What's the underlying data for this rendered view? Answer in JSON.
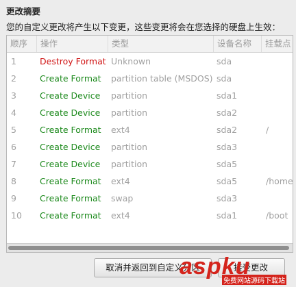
{
  "dialog": {
    "title": "更改摘要",
    "description": "您的自定义更改将产生以下变更，这些变更将会在您选择的硬盘上生效："
  },
  "table": {
    "headers": [
      "顺序",
      "操作",
      "类型",
      "设备名称",
      "挂载点"
    ],
    "rows": [
      {
        "order": "1",
        "action": "Destroy Format",
        "action_kind": "destroy",
        "type": "Unknown",
        "device": "sda",
        "mount": ""
      },
      {
        "order": "2",
        "action": "Create Format",
        "action_kind": "create",
        "type": "partition table (MSDOS)",
        "device": "sda",
        "mount": ""
      },
      {
        "order": "3",
        "action": "Create Device",
        "action_kind": "create",
        "type": "partition",
        "device": "sda1",
        "mount": ""
      },
      {
        "order": "4",
        "action": "Create Device",
        "action_kind": "create",
        "type": "partition",
        "device": "sda2",
        "mount": ""
      },
      {
        "order": "5",
        "action": "Create Format",
        "action_kind": "create",
        "type": "ext4",
        "device": "sda2",
        "mount": "/"
      },
      {
        "order": "6",
        "action": "Create Device",
        "action_kind": "create",
        "type": "partition",
        "device": "sda3",
        "mount": ""
      },
      {
        "order": "7",
        "action": "Create Device",
        "action_kind": "create",
        "type": "partition",
        "device": "sda5",
        "mount": ""
      },
      {
        "order": "8",
        "action": "Create Format",
        "action_kind": "create",
        "type": "ext4",
        "device": "sda5",
        "mount": "/home"
      },
      {
        "order": "9",
        "action": "Create Format",
        "action_kind": "create",
        "type": "swap",
        "device": "sda3",
        "mount": ""
      },
      {
        "order": "10",
        "action": "Create Format",
        "action_kind": "create",
        "type": "ext4",
        "device": "sda1",
        "mount": "/boot"
      }
    ]
  },
  "buttons": {
    "cancel_label": "取消并返回到自定义分区",
    "accept_label": "接受更改"
  },
  "watermark": {
    "logo_text": "aspku",
    "sub_text": "免费网站源码下载站"
  },
  "colors": {
    "destroy": "#d01515",
    "create": "#1d8a1d",
    "muted": "#a0a0a0"
  }
}
